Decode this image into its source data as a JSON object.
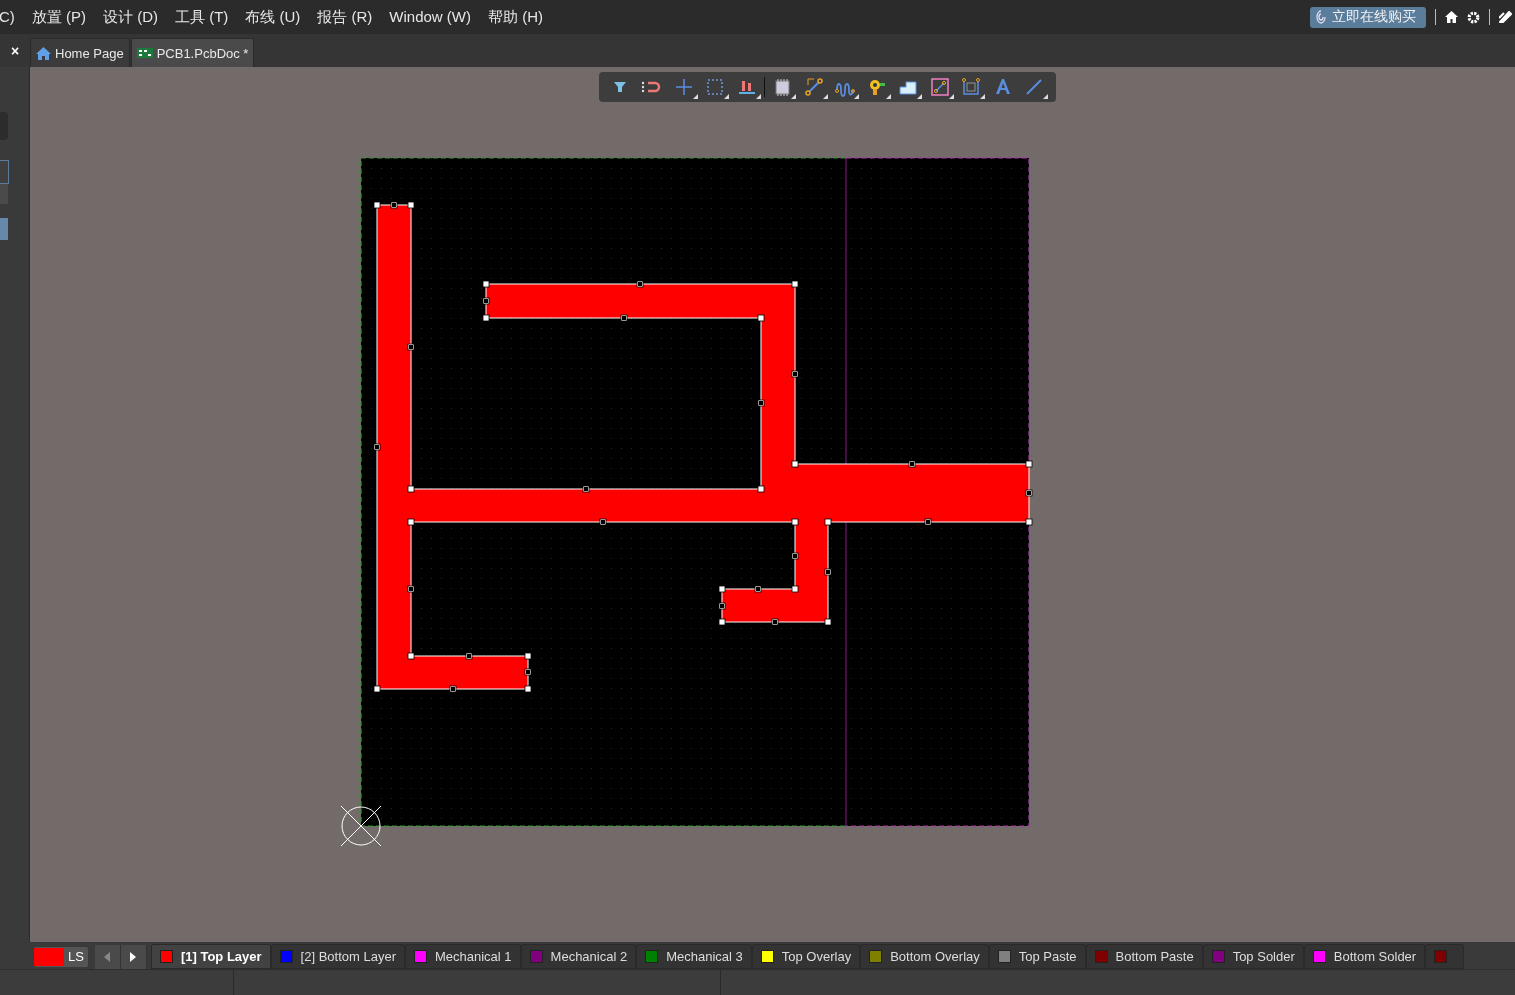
{
  "menu": [
    "C)",
    "放置 (P)",
    "设计 (D)",
    "工具 (T)",
    "布线 (U)",
    "报告 (R)",
    "Window (W)",
    "帮助 (H)"
  ],
  "buy_button": "立即在线购买",
  "close_glyph": "×",
  "tabs": [
    {
      "label": "Home Page",
      "kind": "home",
      "selected": false
    },
    {
      "label": "PCB1.PcbDoc *",
      "kind": "pcb",
      "selected": true
    }
  ],
  "layer_set": {
    "label": "LS",
    "color": "#ff0000"
  },
  "layers": [
    {
      "label": "[1] Top Layer",
      "color": "#ff0000",
      "selected": true
    },
    {
      "label": "[2] Bottom Layer",
      "color": "#0000ff",
      "selected": false
    },
    {
      "label": "Mechanical 1",
      "color": "#ff00ff",
      "selected": false
    },
    {
      "label": "Mechanical 2",
      "color": "#800080",
      "selected": false
    },
    {
      "label": "Mechanical 3",
      "color": "#008000",
      "selected": false
    },
    {
      "label": "Top Overlay",
      "color": "#ffff00",
      "selected": false
    },
    {
      "label": "Bottom Overlay",
      "color": "#808000",
      "selected": false
    },
    {
      "label": "Top Paste",
      "color": "#808080",
      "selected": false
    },
    {
      "label": "Bottom Paste",
      "color": "#800000",
      "selected": false
    },
    {
      "label": "Top Solder",
      "color": "#800080",
      "selected": false
    },
    {
      "label": "Bottom Solder",
      "color": "#ff00ff",
      "selected": false
    },
    {
      "color": "#800000",
      "selected": false
    }
  ]
}
